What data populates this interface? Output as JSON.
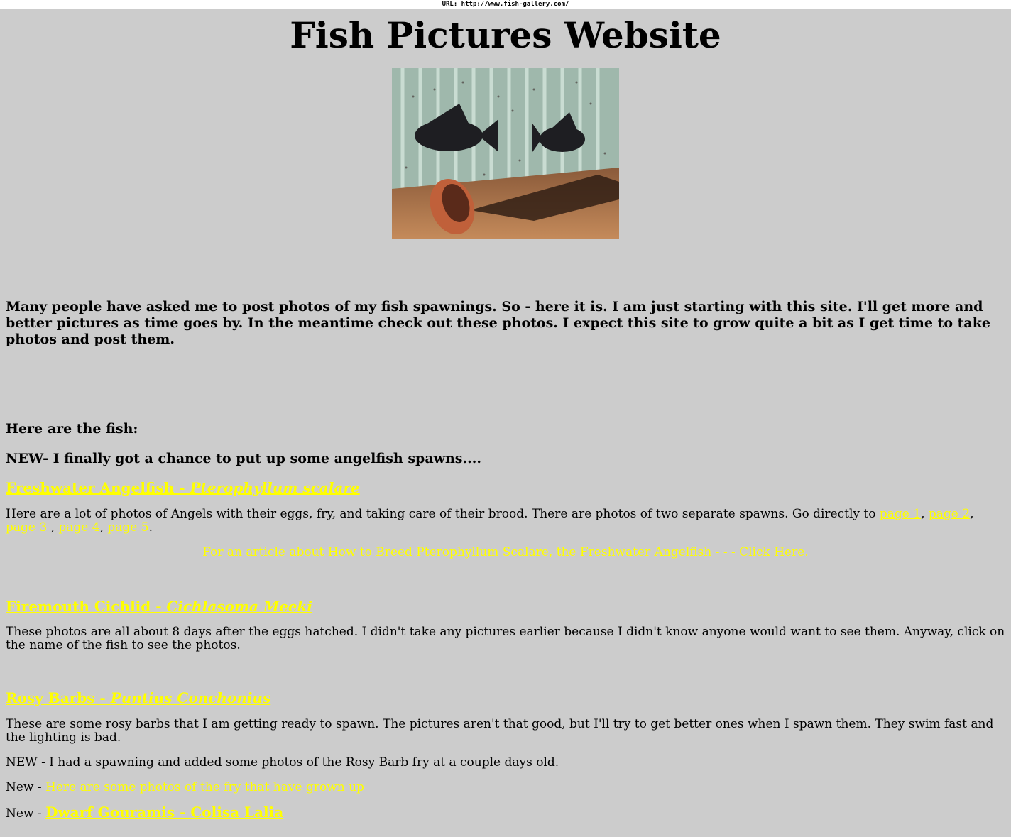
{
  "browser": {
    "url": "URL: http://www.fish-gallery.com/"
  },
  "header": {
    "title": "Fish Pictures Website"
  },
  "intro": "Many people have asked me to post photos of my fish spawnings. So - here it is. I am just starting with this site. I'll get more and better pictures as time goes by. In the meantime check out these photos. I expect this site to grow quite a bit as I get time to take photos and post them.",
  "here_fish": "Here are the fish:",
  "new_angel": "NEW- I finally got a chance to put up some angelfish spawns....",
  "angelfish": {
    "title": "Freshwater Angelfish - ",
    "latin": "Pterophyllum scalare",
    "desc": "Here are a lot of photos of Angels with their eggs, fry, and taking care of their brood. There are photos of two separate spawns. Go directly to ",
    "pages": [
      "page 1",
      "page 2",
      "page 3",
      "page 4",
      "page 5"
    ],
    "article": "For an article about How to Breed Pterophyllum Scalare, the Freshwater Angelfish - - - Click Here."
  },
  "firemouth": {
    "title": "Firemouth Cichlid - ",
    "latin": "Cichlasoma Meeki",
    "desc": "These photos are all about 8 days after the eggs hatched. I didn't take any pictures earlier because I didn't know anyone would want to see them. Anyway, click on the name of the fish to see the photos."
  },
  "rosy": {
    "title": "Rosy Barbs - ",
    "latin": "Puntius Conchonius",
    "desc": "These are some rosy barbs that I am getting ready to spawn. The pictures aren't that good, but I'll try to get better ones when I spawn them. They swim fast and the lighting is bad.",
    "new1": "NEW - I had a spawning and added some photos of the Rosy Barb fry at a couple days old.",
    "new_prefix": "New - ",
    "fry_link": "Here are some photos of the fry that have grown up"
  },
  "gourami": {
    "prefix": "New - ",
    "link": "Dwarf Gouramis - Colisa Lalia"
  },
  "colors": {
    "background": "#cccccc",
    "link": "#ffff00"
  }
}
